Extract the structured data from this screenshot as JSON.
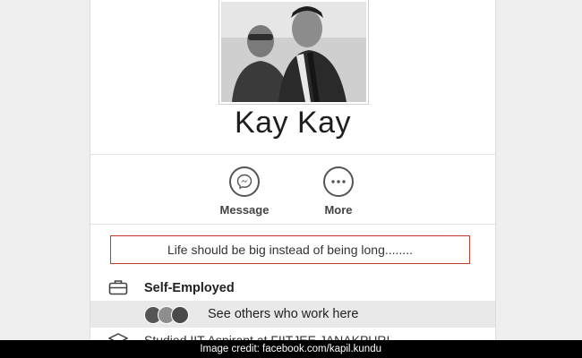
{
  "profile": {
    "name": "Kay Kay"
  },
  "actions": [
    {
      "label": "Message",
      "icon": "messenger-icon"
    },
    {
      "label": "More",
      "icon": "more-icon"
    }
  ],
  "bio": "Life should be big instead of being long........",
  "work": {
    "title": "Self-Employed",
    "see_others": "See others who work here",
    "icon": "briefcase-icon"
  },
  "education": {
    "text": "Studied IIT Aspirant at FIITJEE JANAKPURI",
    "icon": "graduation-cap-icon"
  },
  "credit": "Image credit: facebook.com/kapil.kundu",
  "colors": {
    "bio_border": "#c0392b",
    "credit_bar": "#000000"
  }
}
